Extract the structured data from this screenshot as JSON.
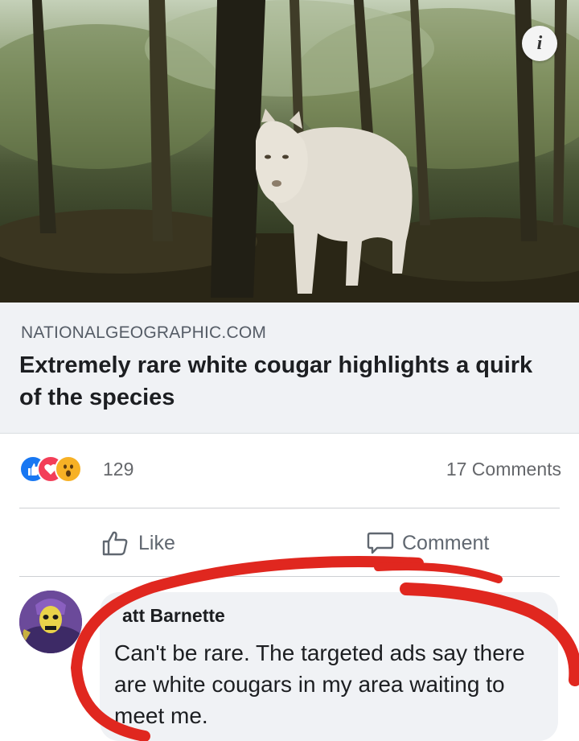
{
  "photo": {
    "info_icon": "i",
    "info_icon_name": "info-icon"
  },
  "link": {
    "domain": "NATIONALGEOGRAPHIC.COM",
    "title": "Extremely rare white cougar highlights a quirk of the species"
  },
  "reactions": {
    "icons": [
      "like-reaction-icon",
      "love-reaction-icon",
      "wow-reaction-icon"
    ],
    "count": "129",
    "comments": "17 Comments"
  },
  "actions": {
    "like_label": "Like",
    "comment_label": "Comment"
  },
  "comment": {
    "author": "att Barnette",
    "text": "Can't be rare. The targeted ads say there are white cougars in my area waiting to meet me."
  },
  "colors": {
    "accent": "#1877f2",
    "love": "#f33e58",
    "wow": "#f7b125",
    "annotation_red": "#e0271f"
  }
}
